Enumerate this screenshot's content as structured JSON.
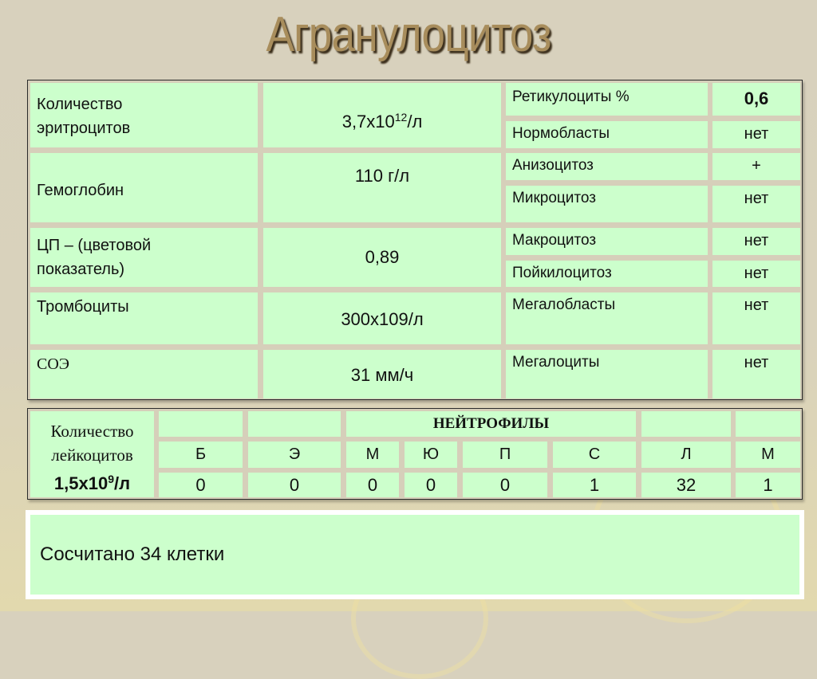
{
  "title": "Агранулоцитоз",
  "blood_table": {
    "left_rows": [
      {
        "label": "Количество эритроцитов",
        "label_line1": "Количество",
        "label_line2": "эритроцитов",
        "value_base": "3,7х10",
        "value_exp": "12",
        "value_unit": "/л"
      },
      {
        "label": "Гемоглобин",
        "value": "110 г/л"
      },
      {
        "label": "ЦП – (цветовой показатель)",
        "label_line1": "ЦП – (цветовой",
        "label_line2": "показатель)",
        "value": "0,89"
      },
      {
        "label": "Тромбоциты",
        "value": "300х109/л"
      },
      {
        "label": "СОЭ",
        "value": "31 мм/ч"
      }
    ],
    "right_rows": [
      {
        "label": "Ретикулоциты %",
        "value": "0,6"
      },
      {
        "label": "Нормобласты",
        "value": "нет"
      },
      {
        "label": "Анизоцитоз",
        "value": "+"
      },
      {
        "label": "Микроцитоз",
        "value": "нет"
      },
      {
        "label": "Макроцитоз",
        "value": "нет"
      },
      {
        "label": "Пойкилоцитоз",
        "value": "нет"
      },
      {
        "label": "Мегалобласты",
        "value": "нет"
      },
      {
        "label": "Мегалоциты",
        "value": "нет"
      }
    ]
  },
  "leukocyte_table": {
    "label_line1": "Количество",
    "label_line2": "лейкоцитов",
    "count_base": "1,5х10",
    "count_exp": "9",
    "count_unit": "/л",
    "group_header": "НЕЙТРОФИЛЫ",
    "columns": [
      "Б",
      "Э",
      "М",
      "Ю",
      "П",
      "С",
      "Л",
      "М"
    ],
    "values": [
      "0",
      "0",
      "0",
      "0",
      "0",
      "1",
      "32",
      "1"
    ]
  },
  "note": "Сосчитано 34 клетки",
  "colors": {
    "cell_bg": "#ccffcc",
    "title": "#a88d5c",
    "background": "#d8d1bd"
  }
}
